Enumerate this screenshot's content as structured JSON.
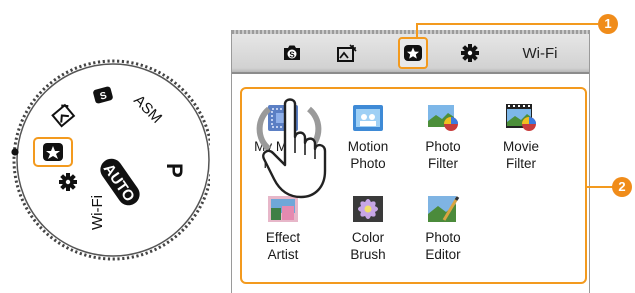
{
  "dial": {
    "labels": [
      "ASM",
      "P",
      "AUTO",
      "Wi-Fi"
    ]
  },
  "screen": {
    "tabs": [
      {
        "name": "tab-smart",
        "icon": "smart-mode-icon"
      },
      {
        "name": "tab-scene",
        "icon": "scene-icon"
      },
      {
        "name": "tab-magic",
        "icon": "magic-star-icon",
        "active": true
      },
      {
        "name": "tab-settings",
        "icon": "gear-icon"
      },
      {
        "name": "tab-wifi",
        "label": "Wi-Fi"
      }
    ],
    "apps": [
      {
        "label": "My Magic\nFrame",
        "icon": "magic-frame-icon"
      },
      {
        "label": "Motion\nPhoto",
        "icon": "motion-photo-icon"
      },
      {
        "label": "Photo\nFilter",
        "icon": "photo-filter-icon"
      },
      {
        "label": "Movie\nFilter",
        "icon": "movie-filter-icon"
      },
      {
        "label": "Effect\nArtist",
        "icon": "effect-artist-icon"
      },
      {
        "label": "Color\nBrush",
        "icon": "color-brush-icon"
      },
      {
        "label": "Photo\nEditor",
        "icon": "photo-editor-icon"
      }
    ]
  },
  "callouts": [
    "1",
    "2"
  ],
  "colors": {
    "accent": "#f39a1e",
    "badge": "#f08c1a"
  }
}
